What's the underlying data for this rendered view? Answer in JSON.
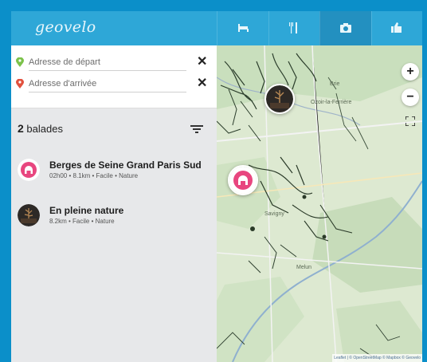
{
  "app": {
    "logo": "geovelo"
  },
  "nav": [
    {
      "label": "",
      "icon": "bed-icon"
    },
    {
      "label": "",
      "icon": "restaurant-icon"
    },
    {
      "label": "",
      "icon": "camera-icon"
    },
    {
      "label": "",
      "icon": "thumbs-up-icon"
    }
  ],
  "address": {
    "start_placeholder": "Adresse de départ",
    "end_placeholder": "Adresse d'arrivée",
    "clear_symbol": "✕"
  },
  "list": {
    "count": "2",
    "count_label": "balades",
    "items": [
      {
        "title": "Berges de Seine Grand Paris Sud",
        "meta": "02h00 • 8.1km • Facile • Nature"
      },
      {
        "title": "En pleine nature",
        "meta": "8.2km • Facile • Nature"
      }
    ]
  },
  "map": {
    "zoom_in": "+",
    "zoom_out": "−",
    "places": [
      "Brie",
      "Ozoir-la-Ferrière",
      "Savigny",
      "Melun"
    ],
    "attribution": "Leaflet | © OpenStreetMap © Mapbox © Geovelo"
  },
  "colors": {
    "topbar": "#2ea7d7",
    "accent_pink": "#e8467f",
    "frame": "#0b8fc9"
  }
}
